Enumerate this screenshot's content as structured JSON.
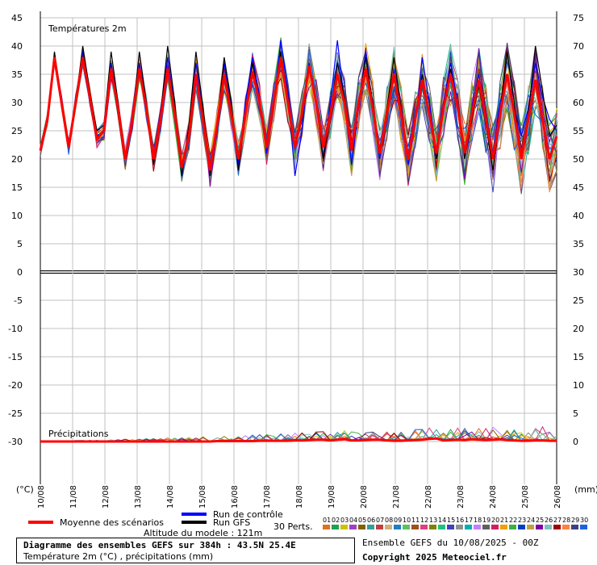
{
  "header": {
    "temp_title": "Températures 2m",
    "precip_title": "Précipitations"
  },
  "axes": {
    "left_unit": "(°C)",
    "right_unit": "(mm)"
  },
  "legend": {
    "mean_label": "Moyenne des scénarios",
    "control_label": "Run de contrôle",
    "gfs_label": "Run GFS",
    "perts_label": "30 Perts.",
    "altitude_label": "Altitude du modele : 121m",
    "pert_numbers": [
      "01",
      "02",
      "03",
      "04",
      "05",
      "06",
      "07",
      "08",
      "09",
      "10",
      "11",
      "12",
      "13",
      "14",
      "15",
      "16",
      "17",
      "18",
      "19",
      "20",
      "21",
      "22",
      "23",
      "24",
      "25",
      "26",
      "27",
      "28",
      "29",
      "30"
    ],
    "pert_colors": [
      "#e07020",
      "#20a050",
      "#d0c000",
      "#a040c0",
      "#806000",
      "#30a0a0",
      "#c04040",
      "#d0b080",
      "#2080c0",
      "#60c060",
      "#a05020",
      "#e04080",
      "#808000",
      "#20c080",
      "#4040c0",
      "#909090",
      "#00b0b0",
      "#c080ff",
      "#606060",
      "#d02060",
      "#f0a000",
      "#40b040",
      "#0040c0",
      "#c0a040",
      "#8000a0",
      "#80c0c0",
      "#a00000",
      "#ff8040",
      "#404080",
      "#2060e0"
    ]
  },
  "footer": {
    "title": "Diagramme des ensembles GEFS sur 384h : 43.5N 25.4E",
    "subtitle": "Température 2m (°C) , précipitations (mm)",
    "ensemble": "Ensemble GEFS du 10/08/2025 - 00Z",
    "copyright": "Copyright 2025 Meteociel.fr"
  },
  "colors": {
    "mean": "#ff0000",
    "control": "#0000ff",
    "gfs": "#000000",
    "grid": "#c0c0c0"
  },
  "chart_data": {
    "type": "line",
    "x_dates": [
      "10/08",
      "11/08",
      "12/08",
      "13/08",
      "14/08",
      "15/08",
      "16/08",
      "17/08",
      "18/08",
      "19/08",
      "20/08",
      "21/08",
      "22/08",
      "23/08",
      "24/08",
      "25/08",
      "26/08"
    ],
    "left_ticks": [
      "45",
      "40",
      "35",
      "30",
      "25",
      "20",
      "15",
      "10",
      "5",
      "0",
      "-5",
      "-10",
      "-15",
      "-20",
      "-25",
      "-30"
    ],
    "right_ticks": [
      "75",
      "70",
      "65",
      "60",
      "55",
      "50",
      "45",
      "40",
      "35",
      "30",
      "25",
      "20",
      "15",
      "10",
      "5",
      "0"
    ],
    "ylim_left": [
      -30,
      45
    ],
    "ylim_right_temp": [
      30,
      75
    ],
    "ylim_right_precip": [
      0,
      15
    ],
    "temp_mean": [
      21.5,
      27,
      38,
      30,
      22,
      30,
      38,
      31,
      23.5,
      25,
      36,
      29,
      20,
      27,
      36,
      29,
      20,
      27,
      36,
      28,
      18.5,
      24,
      35,
      27,
      18,
      26,
      35,
      28,
      20,
      28,
      35.5,
      30,
      22,
      30,
      38,
      30,
      22,
      28,
      36.5,
      30,
      22,
      28,
      35,
      30,
      21.5,
      30,
      36,
      29,
      21,
      28,
      35,
      28,
      20,
      27,
      34,
      28,
      21,
      29,
      35,
      29,
      21,
      28,
      34,
      27,
      20,
      28,
      35,
      28,
      20,
      27,
      34,
      27,
      20,
      24
    ],
    "temp_gfs": [
      21.5,
      27,
      39,
      30,
      22,
      30,
      40,
      32,
      25,
      26,
      39,
      30,
      20,
      27,
      39,
      30,
      19,
      28,
      40,
      30,
      17,
      26,
      39,
      29,
      17,
      26,
      38,
      30,
      18,
      28,
      37,
      30,
      22,
      30,
      39,
      31,
      22,
      27,
      36,
      30,
      20,
      28,
      37,
      31,
      22,
      30,
      38,
      30,
      21,
      29,
      38,
      29,
      20,
      27,
      35,
      28,
      20,
      29,
      36,
      29,
      20,
      27,
      33,
      26,
      18,
      28,
      39,
      30,
      20,
      28,
      40,
      32,
      24,
      26
    ],
    "temp_control": [
      21.5,
      27,
      38,
      31,
      22,
      30,
      39,
      31,
      24,
      25,
      37,
      30,
      20,
      27,
      37,
      30,
      19,
      27,
      38,
      29,
      17,
      25,
      37,
      28,
      17,
      25,
      37,
      29,
      19,
      30,
      38,
      31,
      21,
      29,
      41,
      32,
      17,
      25,
      37,
      30,
      20,
      30,
      41,
      30,
      19,
      29,
      39,
      29,
      20,
      28,
      36,
      29,
      19,
      26,
      38,
      30,
      21,
      30,
      37,
      30,
      21,
      29,
      35,
      28,
      21,
      30,
      35,
      29,
      24,
      29,
      37,
      31,
      27,
      25
    ],
    "precip_mean": [
      0,
      0,
      0,
      0,
      0,
      0,
      0,
      0,
      0,
      0,
      0,
      0,
      0,
      0,
      0,
      0,
      0,
      0,
      0,
      0,
      0,
      0,
      0,
      0,
      0,
      0.1,
      0.1,
      0.1,
      0.1,
      0.1,
      0.1,
      0.2,
      0.2,
      0.2,
      0.2,
      0.2,
      0.3,
      0.3,
      0.4,
      0.5,
      0.5,
      0.3,
      0.5,
      0.6,
      0.3,
      0.3,
      0.4,
      0.5,
      0.5,
      0.3,
      0.2,
      0.2,
      0.3,
      0.4,
      0.5,
      0.7,
      0.8,
      0.3,
      0.4,
      0.5,
      0.4,
      0.6,
      0.5,
      0.4,
      0.5,
      0.6,
      0.4,
      0.3,
      0.2,
      0.2,
      0.3,
      0.3,
      0.2,
      0.2
    ]
  }
}
